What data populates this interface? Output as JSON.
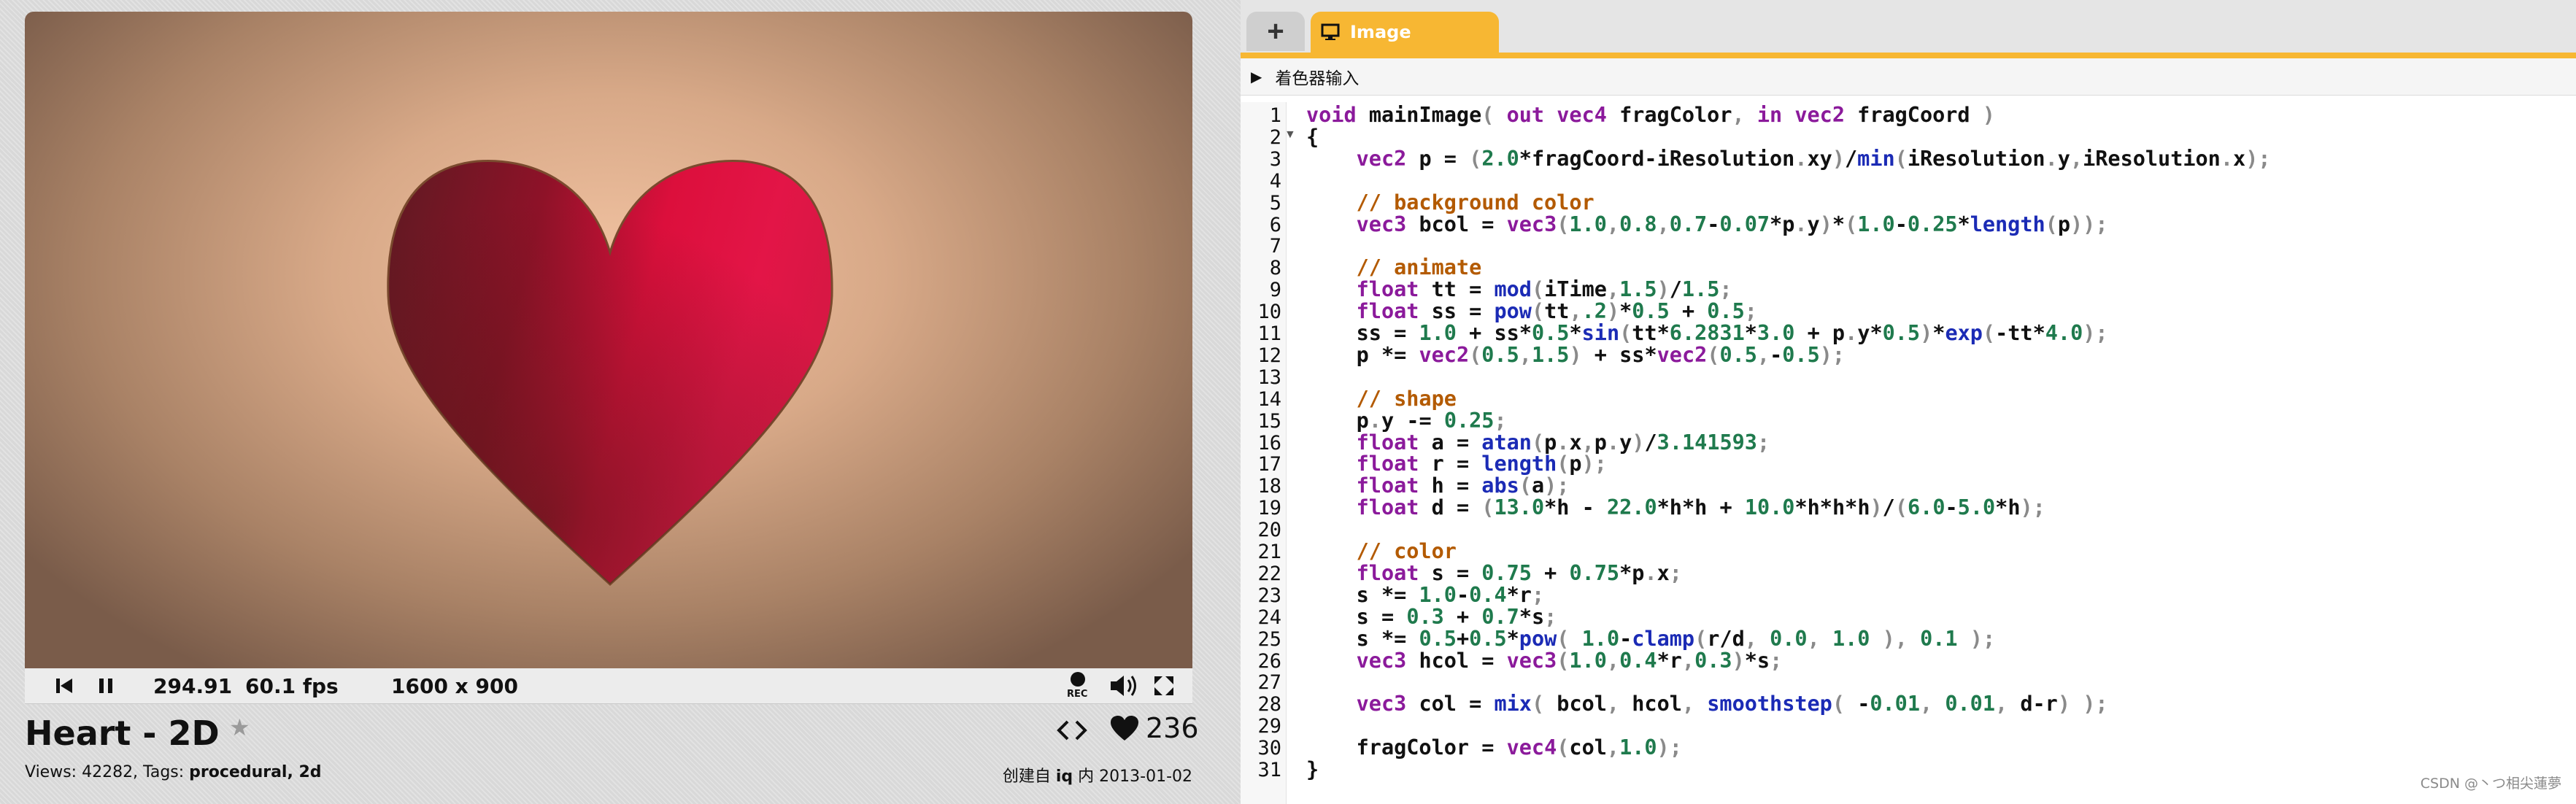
{
  "viewer": {
    "time": "294.91",
    "fps": "60.1 fps",
    "resolution": "1600 x 900",
    "rec_label": "REC"
  },
  "shader": {
    "title": "Heart - 2D",
    "views_prefix": "Views: 42282, Tags: ",
    "tags": "procedural, 2d",
    "likes": "236",
    "created_prefix": "创建自 ",
    "author": "iq",
    "created_suffix": " 内 2013-01-02"
  },
  "editor": {
    "add_tab_label": "+",
    "image_tab_label": "Image",
    "shader_inputs_label": "着色器输入",
    "line_numbers": [
      "1",
      "2",
      "3",
      "4",
      "5",
      "6",
      "7",
      "8",
      "9",
      "10",
      "11",
      "12",
      "13",
      "14",
      "15",
      "16",
      "17",
      "18",
      "19",
      "20",
      "21",
      "22",
      "23",
      "24",
      "25",
      "26",
      "27",
      "28",
      "29",
      "30",
      "31"
    ],
    "code_lines": [
      "void mainImage( out vec4 fragColor, in vec2 fragCoord )",
      "{",
      "    vec2 p = (2.0*fragCoord-iResolution.xy)/min(iResolution.y,iResolution.x);",
      "",
      "    // background color",
      "    vec3 bcol = vec3(1.0,0.8,0.7-0.07*p.y)*(1.0-0.25*length(p));",
      "",
      "    // animate",
      "    float tt = mod(iTime,1.5)/1.5;",
      "    float ss = pow(tt,.2)*0.5 + 0.5;",
      "    ss = 1.0 + ss*0.5*sin(tt*6.2831*3.0 + p.y*0.5)*exp(-tt*4.0);",
      "    p *= vec2(0.5,1.5) + ss*vec2(0.5,-0.5);",
      "",
      "    // shape",
      "    p.y -= 0.25;",
      "    float a = atan(p.x,p.y)/3.141593;",
      "    float r = length(p);",
      "    float h = abs(a);",
      "    float d = (13.0*h - 22.0*h*h + 10.0*h*h*h)/(6.0-5.0*h);",
      "",
      "    // color",
      "    float s = 0.75 + 0.75*p.x;",
      "    s *= 1.0-0.4*r;",
      "    s = 0.3 + 0.7*s;",
      "    s *= 0.5+0.5*pow( 1.0-clamp(r/d, 0.0, 1.0 ), 0.1 );",
      "    vec3 hcol = vec3(1.0,0.4*r,0.3)*s;",
      "",
      "    vec3 col = mix( bcol, hcol, smoothstep( -0.01, 0.01, d-r) );",
      "",
      "    fragColor = vec4(col,1.0);",
      "}"
    ]
  },
  "watermark": "CSDN @丶つ相尖蓮夢",
  "colors": {
    "tab_accent": "#f7b733",
    "heart_light": "#e0123e",
    "heart_dark": "#5e1a22"
  }
}
